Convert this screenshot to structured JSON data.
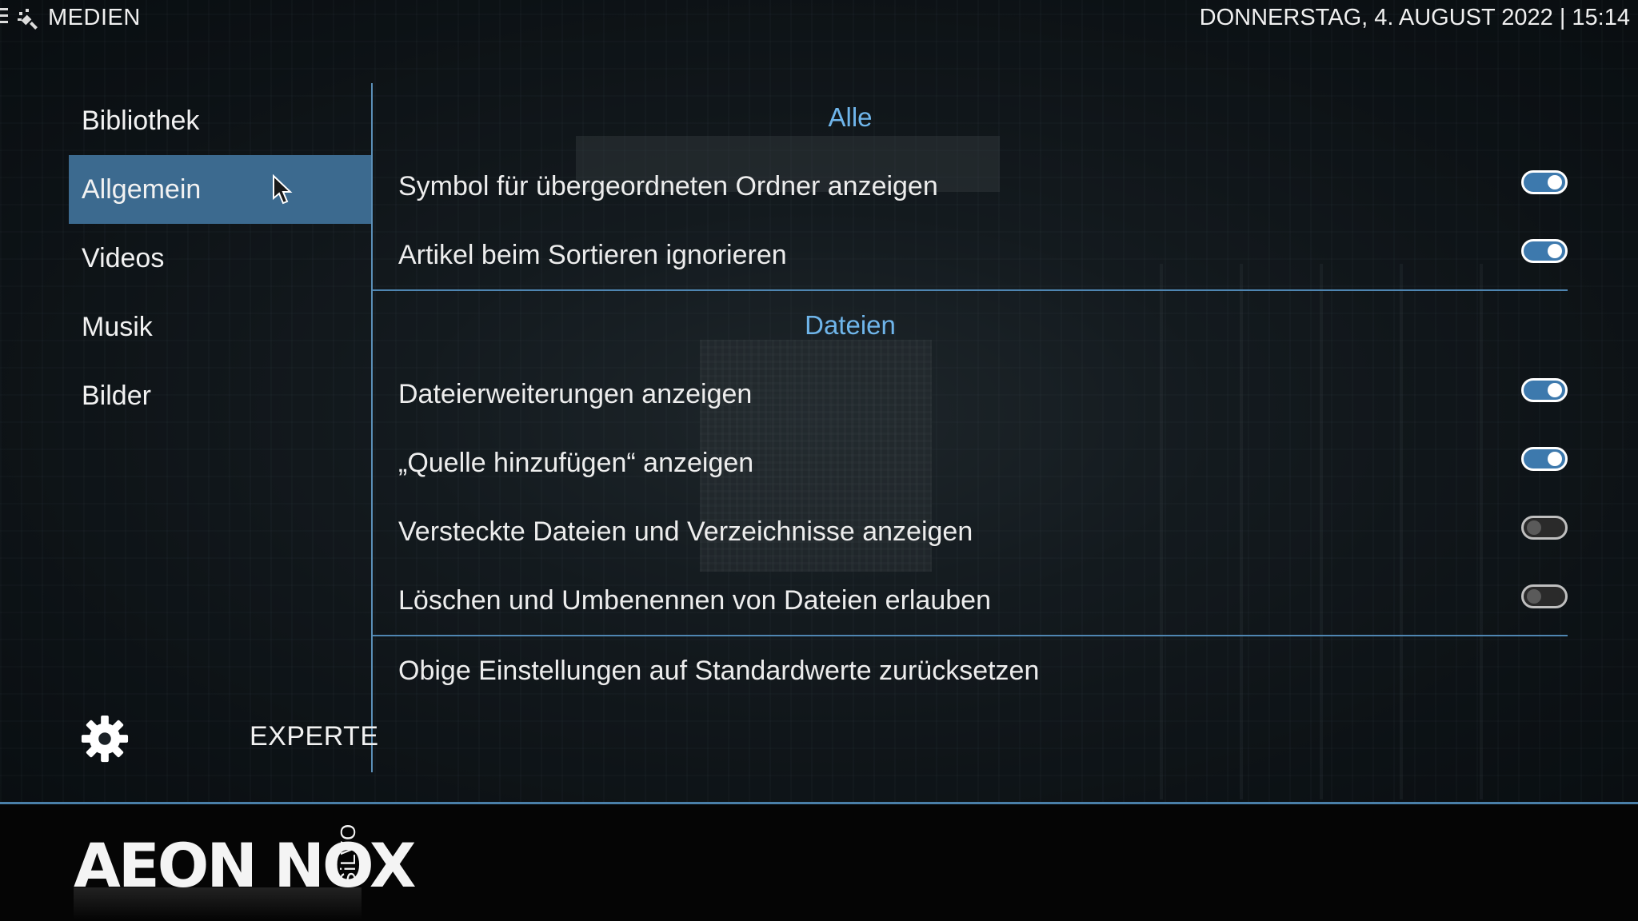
{
  "topbar": {
    "section_title": "MEDIEN",
    "datetime": "DONNERSTAG, 4. AUGUST 2022 | 15:14"
  },
  "sidebar": {
    "items": [
      {
        "label": "Bibliothek",
        "active": false
      },
      {
        "label": "Allgemein",
        "active": true
      },
      {
        "label": "Videos",
        "active": false
      },
      {
        "label": "Musik",
        "active": false
      },
      {
        "label": "Bilder",
        "active": false
      }
    ],
    "level_label": "EXPERTE"
  },
  "settings": {
    "group_all": "Alle",
    "group_files": "Dateien",
    "rows": [
      {
        "label": "Symbol für übergeordneten Ordner anzeigen",
        "enabled": true
      },
      {
        "label": "Artikel beim Sortieren ignorieren",
        "enabled": true
      },
      {
        "label": "Dateierweiterungen anzeigen",
        "enabled": true
      },
      {
        "label": "„Quelle hinzufügen“ anzeigen",
        "enabled": true
      },
      {
        "label": "Versteckte Dateien und Verzeichnisse anzeigen",
        "enabled": false
      },
      {
        "label": "Löschen und Umbenennen von Dateien erlauben",
        "enabled": false
      }
    ],
    "reset_label": "Obige Einstellungen auf Standardwerte zurücksetzen"
  },
  "footer": {
    "logo": "AEON NOX",
    "logo_sub": "SiLVO"
  },
  "colors": {
    "accent": "#3c6a8f",
    "header_blue": "#6fb5ea",
    "toggle_on": "#3d79ad"
  }
}
